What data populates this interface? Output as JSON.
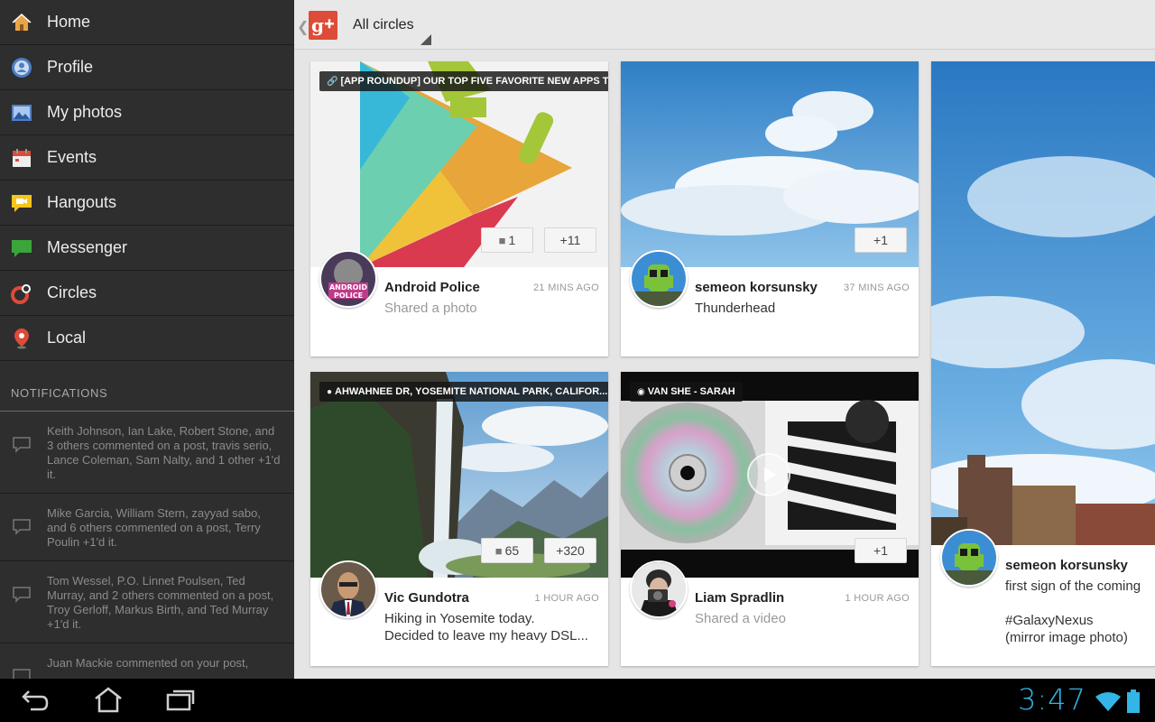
{
  "sidebar": {
    "items": [
      {
        "label": "Home",
        "icon": "home-icon"
      },
      {
        "label": "Profile",
        "icon": "profile-icon"
      },
      {
        "label": "My photos",
        "icon": "photos-icon"
      },
      {
        "label": "Events",
        "icon": "events-icon"
      },
      {
        "label": "Hangouts",
        "icon": "hangouts-icon"
      },
      {
        "label": "Messenger",
        "icon": "messenger-icon"
      },
      {
        "label": "Circles",
        "icon": "circles-icon"
      },
      {
        "label": "Local",
        "icon": "local-pin-icon"
      }
    ],
    "notifications_header": "NOTIFICATIONS",
    "notifications": [
      {
        "text": "Keith Johnson, Ian Lake, Robert Stone, and 3 others commented on a post, travis serio, Lance Coleman, Sam Nalty, and 1 other +1'd it."
      },
      {
        "text": "Mike Garcia, William Stern, zayyad sabo, and 6 others commented on a post, Terry Poulin +1'd it."
      },
      {
        "text": "Tom Wessel, P.O. Linnet Poulsen, Ted Murray, and 2 others commented on a post, Troy Gerloff, Markus Birth, and Ted Murray +1'd it."
      },
      {
        "text": "Juan Mackie commented on your post,"
      }
    ]
  },
  "topbar": {
    "app_icon": "google-plus-logo",
    "circles_label": "All circles"
  },
  "cards": [
    {
      "tag": "[APP ROUNDUP] OUR TOP FIVE FAVORITE NEW APPS T...",
      "tag_icon": "link-icon",
      "comments": "1",
      "plus_ones": "+11",
      "author": "Android Police",
      "time": "21 MINS AGO",
      "body": "Shared a photo",
      "avatar_text": "ANDROID POLICE"
    },
    {
      "plus_ones": "+1",
      "author": "semeon korsunsky",
      "time": "37 MINS AGO",
      "body": "Thunderhead"
    },
    {
      "tag": "AHWAHNEE DR, YOSEMITE NATIONAL PARK, CALIFOR...",
      "tag_icon": "location-icon",
      "comments": "65",
      "plus_ones": "+320",
      "author": "Vic Gundotra",
      "time": "1 HOUR AGO",
      "body_line1": "Hiking in Yosemite today.",
      "body_line2": "Decided to leave my heavy DSL..."
    },
    {
      "tag": "VAN SHE - SARAH",
      "tag_icon": "media-icon",
      "plus_ones": "+1",
      "author": "Liam Spradlin",
      "time": "1 HOUR AGO",
      "body": "Shared a video"
    },
    {
      "author": "semeon korsunsky",
      "body_line1": "first sign of the coming",
      "body_line3": "#GalaxyNexus",
      "body_line4": "(mirror image photo)"
    }
  ],
  "system": {
    "clock": "3:47",
    "accent": "#33b5e5"
  }
}
